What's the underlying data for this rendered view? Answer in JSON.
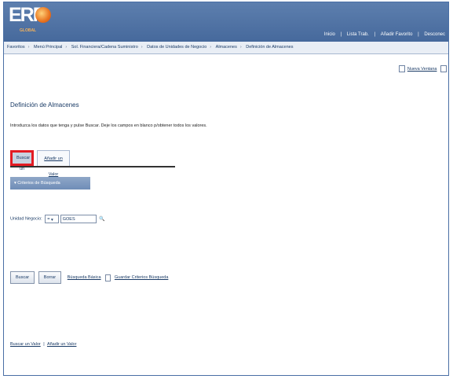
{
  "banner": {
    "logo_text": "ERP",
    "logo_tag": "GLOBAL",
    "links": [
      "Inicio",
      "Lista Trab.",
      "Añadir Favorito",
      "Desconec"
    ]
  },
  "breadcrumb": [
    "Favoritos",
    "Menú Principal",
    "Sol. Financiera/Cadena Suministro",
    "Datos de Unidades de Negocio",
    "Almacenes",
    "Definición de Almacenes"
  ],
  "toplinks": {
    "new_window": "Nueva Ventana"
  },
  "page": {
    "title": "Definición de Almacenes",
    "instructions": "Introduzca los datos que tenga y pulse Buscar. Deje los campos en blanco p/obtener todos los valores."
  },
  "tabs": {
    "search": "Buscar un Valor",
    "add": "Añadir un Valor"
  },
  "section": {
    "title": "Criterios de Búsqueda"
  },
  "field": {
    "label": "Unidad Negocio:",
    "operator": "=",
    "value": "GOES"
  },
  "actions": {
    "search_button": "Buscar",
    "clear_button": "Borrar",
    "basic_search": "Búsqueda Básica",
    "save_criteria": "Guardar Criterios Búsqueda"
  },
  "bottom": {
    "search_link": "Buscar un Valor",
    "add_link": "Añadir un Valor"
  },
  "colors": {
    "banner": "#4f73a5",
    "highlight": "#e31b23",
    "text": "#1a3b66"
  }
}
